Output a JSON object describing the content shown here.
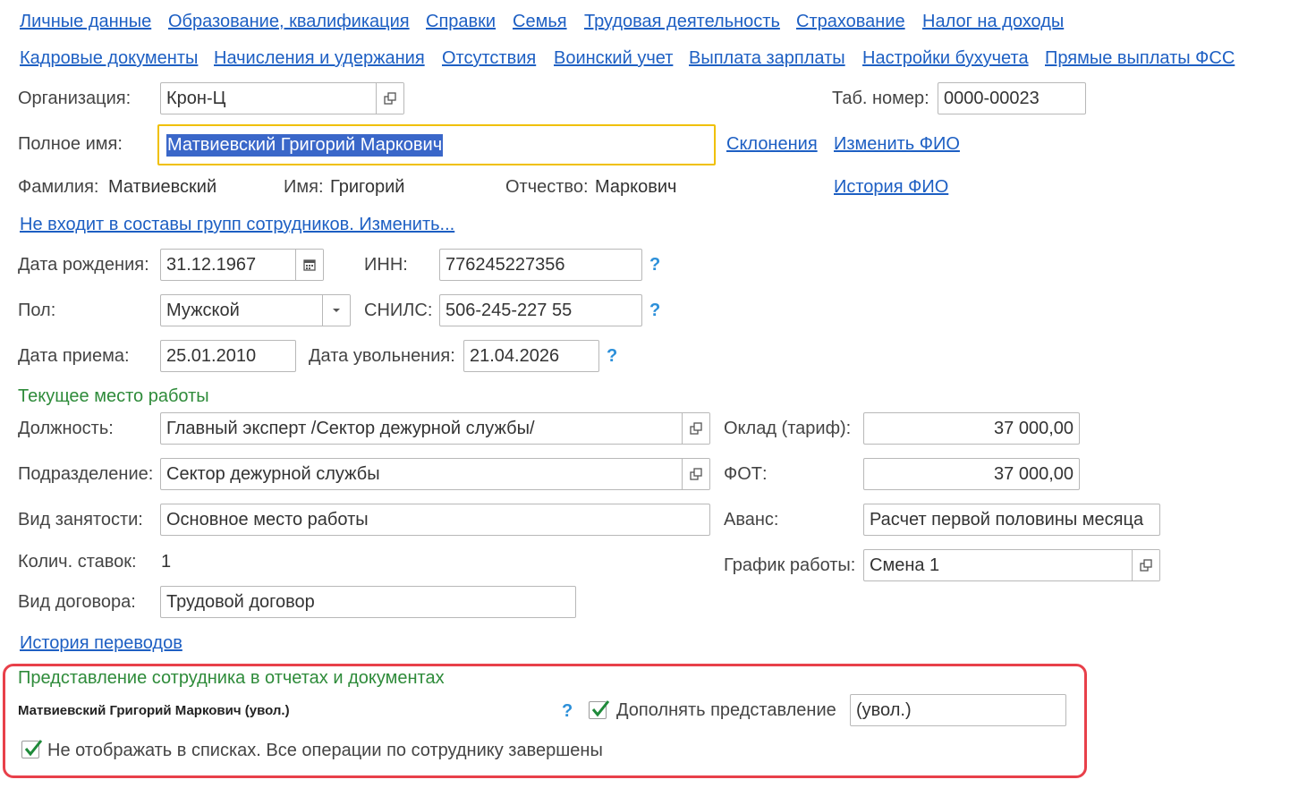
{
  "nav_row1": [
    "Личные данные",
    "Образование, квалификация",
    "Справки",
    "Семья",
    "Трудовая деятельность",
    "Страхование",
    "Налог на доходы"
  ],
  "nav_row2": [
    "Кадровые документы",
    "Начисления и удержания",
    "Отсутствия",
    "Воинский учет",
    "Выплата зарплаты",
    "Настройки бухучета",
    "Прямые выплаты ФСС"
  ],
  "org": {
    "label": "Организация:",
    "value": "Крон-Ц"
  },
  "tab": {
    "label": "Таб. номер:",
    "value": "0000-00023"
  },
  "fullname": {
    "label": "Полное имя:",
    "value": "Матвиевский Григорий Маркович",
    "declensions": "Склонения",
    "change": "Изменить ФИО",
    "history": "История ФИО"
  },
  "parts": {
    "surname_label": "Фамилия:",
    "surname": "Матвиевский",
    "name_label": "Имя:",
    "name": "Григорий",
    "patronymic_label": "Отчество:",
    "patronymic": "Маркович"
  },
  "groups_link": "Не входит в составы групп сотрудников. Изменить...",
  "birth": {
    "label": "Дата рождения:",
    "value": "31.12.1967"
  },
  "inn": {
    "label": "ИНН:",
    "value": "776245227356"
  },
  "gender": {
    "label": "Пол:",
    "value": "Мужской"
  },
  "snils": {
    "label": "СНИЛС:",
    "value": "506-245-227 55"
  },
  "hire": {
    "label": "Дата приема:",
    "value": "25.01.2010"
  },
  "dismiss": {
    "label": "Дата увольнения:",
    "value": "21.04.2026"
  },
  "help_mark": "?",
  "current_work": {
    "title": "Текущее место работы",
    "position_label": "Должность:",
    "position": "Главный эксперт /Сектор дежурной службы/",
    "department_label": "Подразделение:",
    "department": "Сектор дежурной службы",
    "employment_label": "Вид занятости:",
    "employment": "Основное место работы",
    "rates_label": "Колич. ставок:",
    "rates": "1",
    "contract_label": "Вид договора:",
    "contract": "Трудовой договор",
    "salary_label": "Оклад (тариф):",
    "salary": "37 000,00",
    "fot_label": "ФОТ:",
    "fot": "37 000,00",
    "advance_label": "Аванс:",
    "advance": "Расчет первой половины месяца",
    "schedule_label": "График работы:",
    "schedule": "Смена 1"
  },
  "transfers_link": "История переводов",
  "representation": {
    "title": "Представление сотрудника в отчетах и документах",
    "text": "Матвиевский Григорий Маркович (увол.)",
    "supplement_label": "Дополнять представление",
    "supplement_checked": true,
    "supplement_value": "(увол.)",
    "hide_label": "Не отображать в списках. Все операции по сотруднику завершены",
    "hide_checked": true
  },
  "colors": {
    "link": "#1d5fc3",
    "section": "#2e8b3a",
    "focus": "#f0c000",
    "highlight": "#e8404a",
    "selection": "#3a67c9"
  }
}
